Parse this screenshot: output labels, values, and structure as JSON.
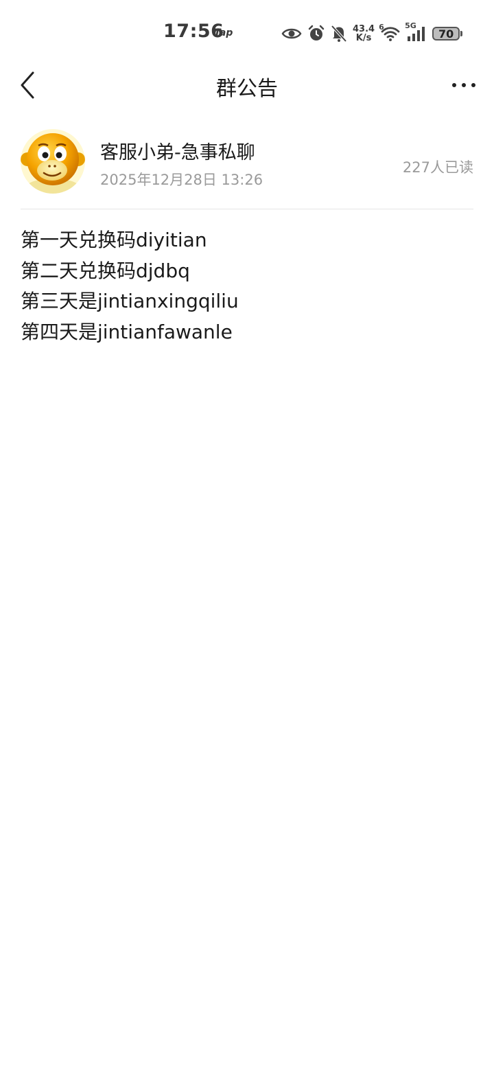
{
  "status_bar": {
    "time": "17:56",
    "tap_label": "Tap",
    "net_speed_value": "43.4",
    "net_speed_unit": "K/s",
    "wifi_tag": "6",
    "cell_tag": "5G",
    "battery": "70",
    "icons": [
      "eye-icon",
      "alarm-icon",
      "bell-muted-icon",
      "wifi-icon",
      "signal-icon",
      "battery-icon"
    ]
  },
  "nav": {
    "title": "群公告",
    "back_icon": "chevron-left-icon",
    "more_icon": "more-horizontal-icon"
  },
  "author": {
    "name": "客服小弟-急事私聊",
    "time": "2025年12月28日 13:26",
    "read_count": "227人已读"
  },
  "content": {
    "lines": [
      "第一天兑换码diyitian",
      "第二天兑换码djdbq",
      "第三天是jintianxingqiliu",
      "第四天是jintianfawanle"
    ]
  }
}
